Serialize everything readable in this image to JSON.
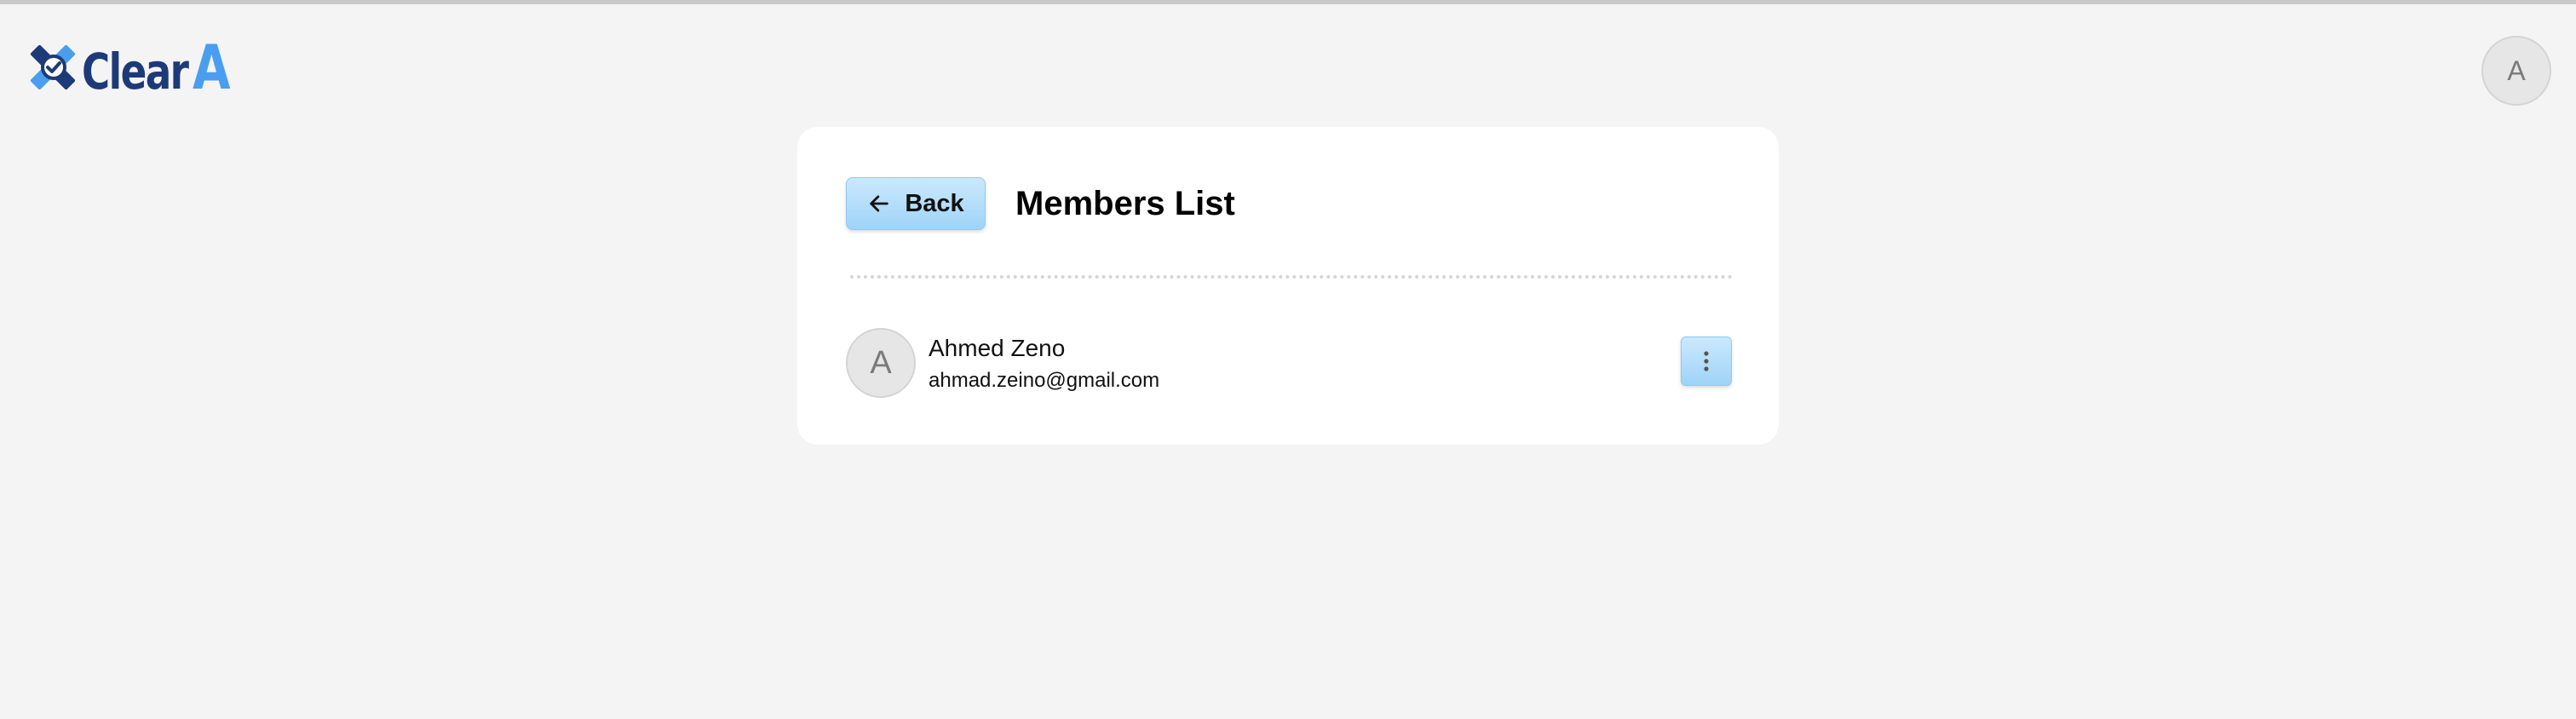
{
  "header": {
    "logo": {
      "text_main": "Clear",
      "text_accent": "A",
      "colors": {
        "main": "#1d3a78",
        "accent": "#4a9ef0"
      }
    },
    "user_avatar_initial": "A"
  },
  "card": {
    "back_button": {
      "label": "Back",
      "icon": "arrow-left-icon"
    },
    "title": "Members List",
    "members": [
      {
        "initial": "A",
        "name": "Ahmed Zeno",
        "email": "ahmad.zeino@gmail.com",
        "menu_icon": "more-vertical-icon"
      }
    ]
  },
  "colors": {
    "background": "#f4f4f4",
    "card": "#ffffff",
    "button_gradient_top": "#cbe9fd",
    "button_gradient_bottom": "#9fd3f8"
  }
}
